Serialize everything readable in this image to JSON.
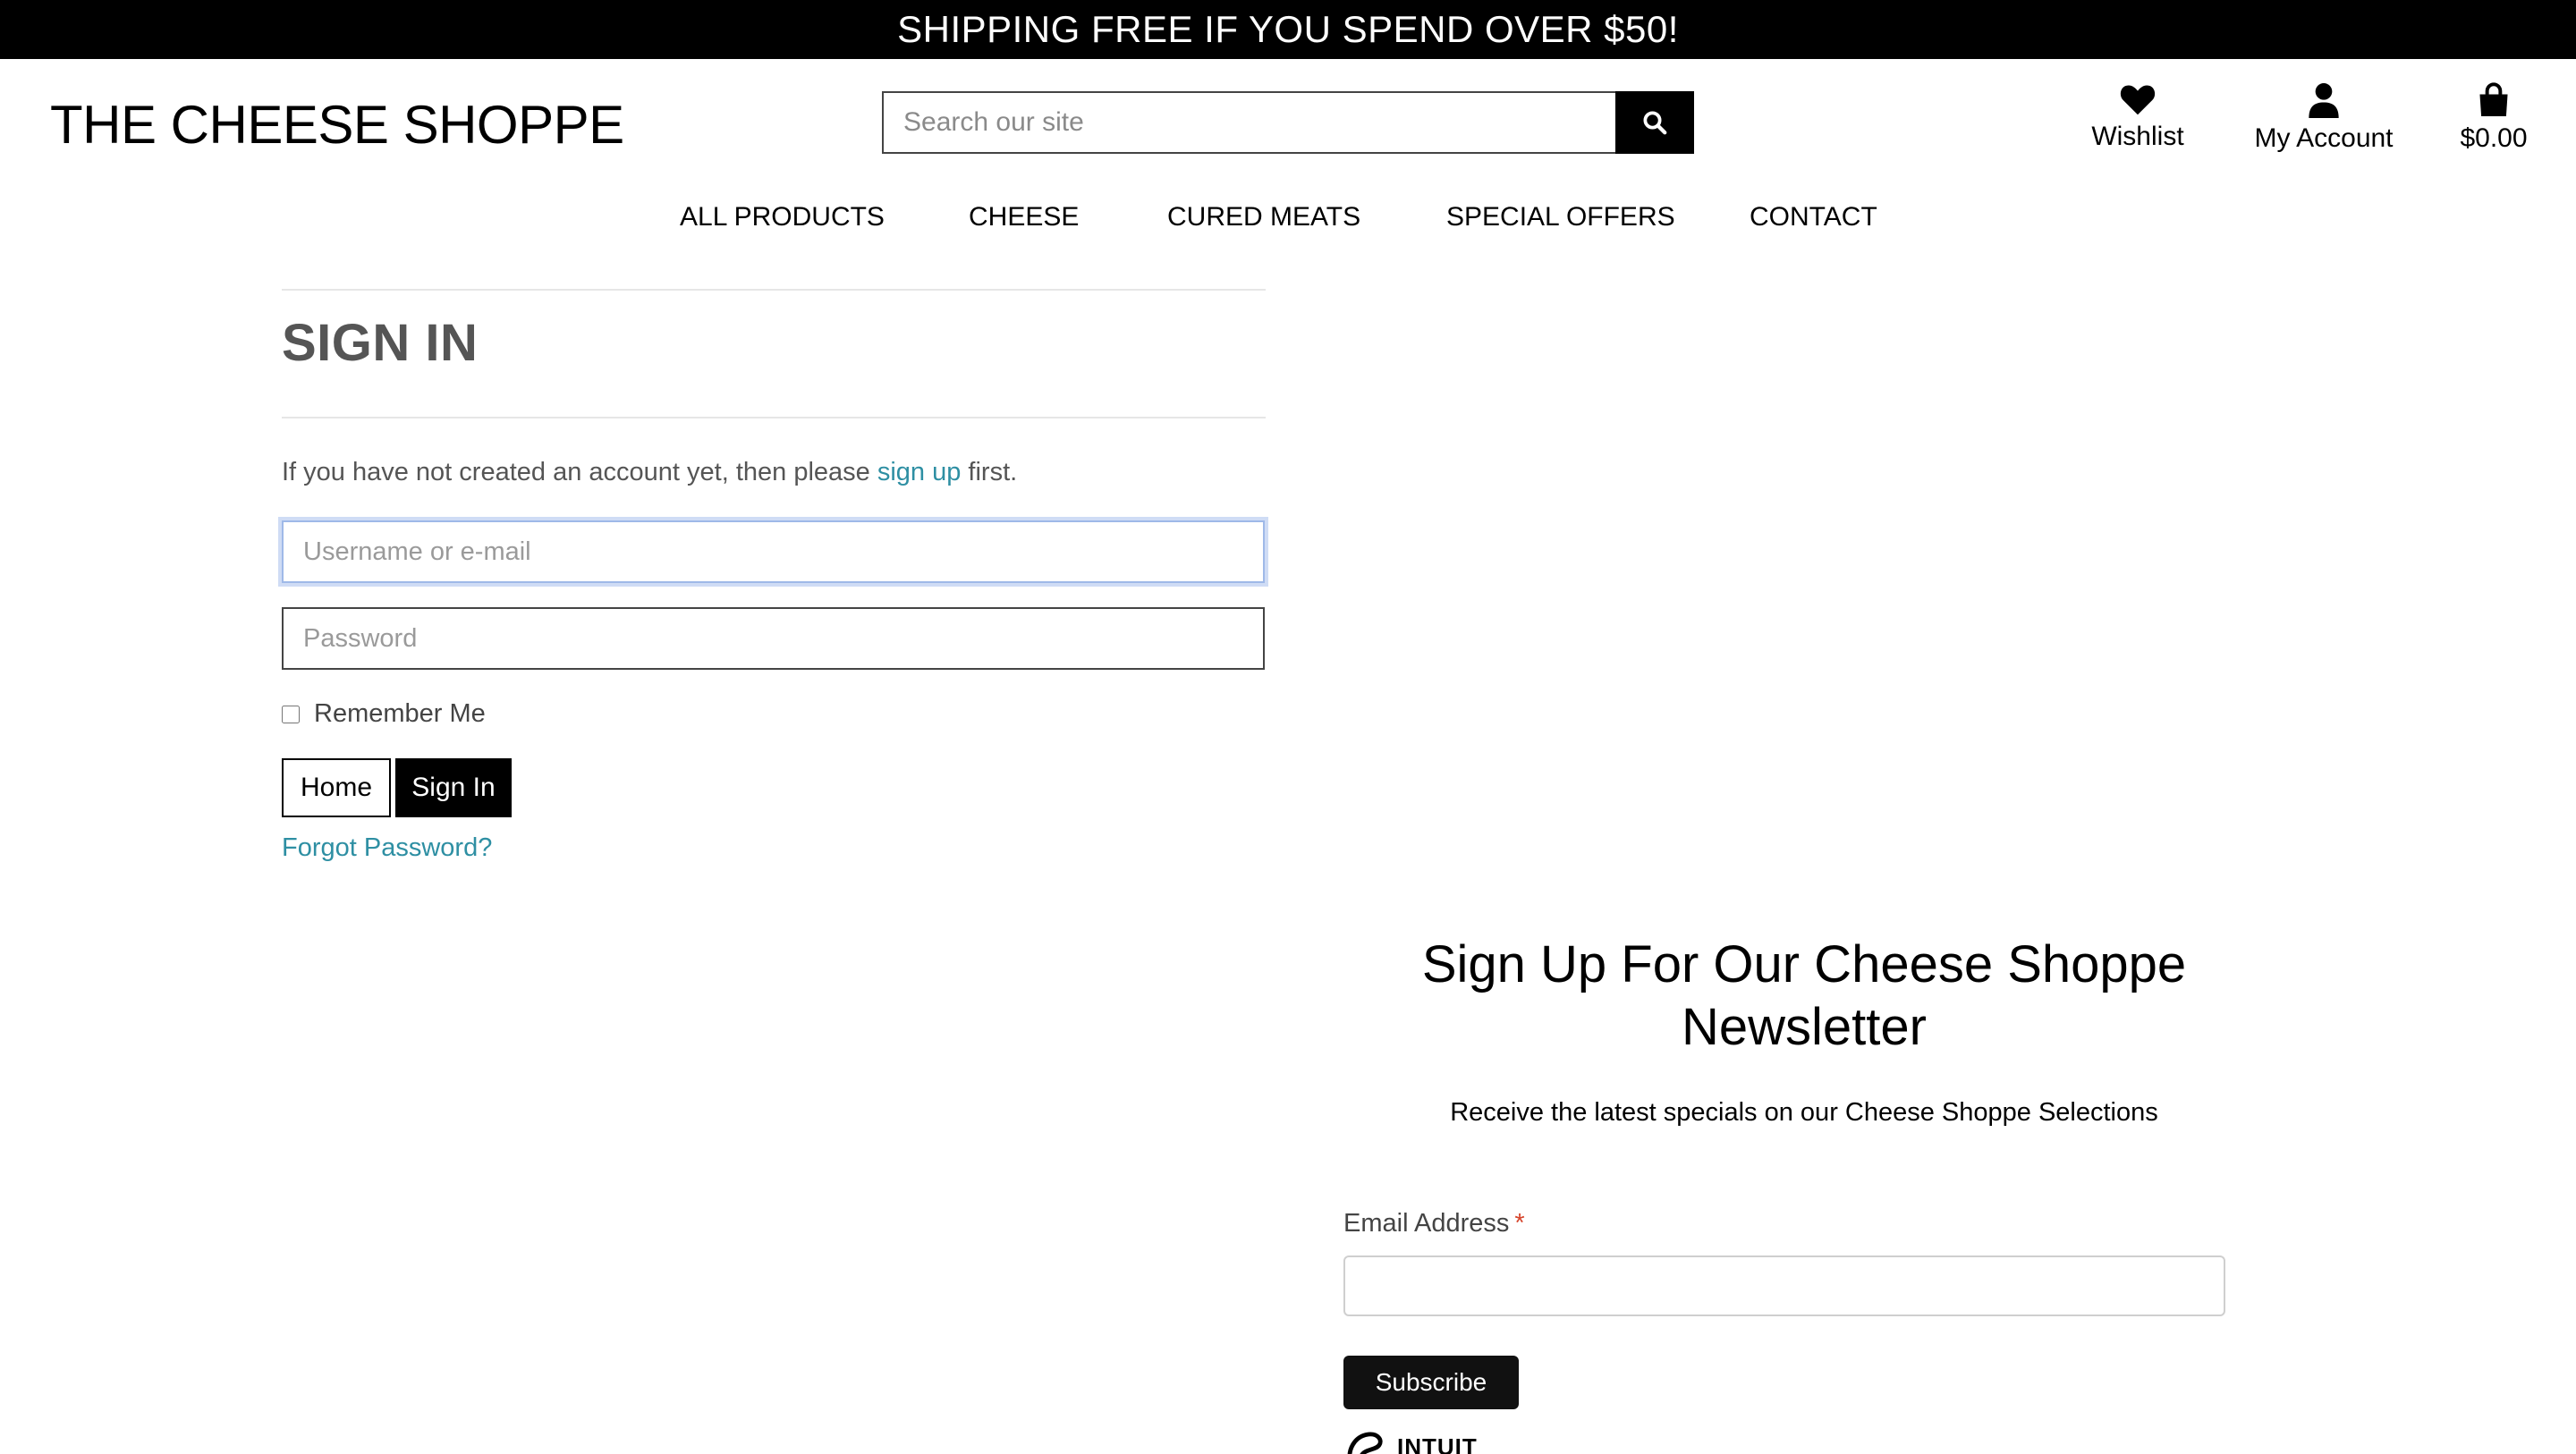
{
  "banner": {
    "text": "SHIPPING FREE IF YOU SPEND OVER $50!"
  },
  "header": {
    "logo": "THE CHEESE SHOPPE",
    "search": {
      "placeholder": "Search our site",
      "icon": "search-icon"
    },
    "links": {
      "wishlist": {
        "label": "Wishlist",
        "icon": "heart-icon"
      },
      "account": {
        "label": "My Account",
        "icon": "user-icon"
      },
      "cart": {
        "label": "$0.00",
        "icon": "shopping-bag-icon"
      }
    }
  },
  "nav": {
    "items": [
      "ALL PRODUCTS",
      "CHEESE",
      "CURED MEATS",
      "SPECIAL OFFERS",
      "CONTACT"
    ]
  },
  "signin": {
    "title": "SIGN IN",
    "intro_before": "If you have not created an account yet, then please ",
    "intro_link": "sign up",
    "intro_after": " first.",
    "username_placeholder": "Username or e-mail",
    "password_placeholder": "Password",
    "remember_label": "Remember Me",
    "home_button": "Home",
    "signin_button": "Sign In",
    "forgot_link": "Forgot Password?"
  },
  "newsletter": {
    "title_line1": "Sign Up For Our Cheese Shoppe",
    "title_line2": "Newsletter",
    "subtitle": "Receive the latest specials on our Cheese Shoppe Selections",
    "email_label": "Email Address",
    "required_mark": "*",
    "subscribe_button": "Subscribe",
    "intuit_text": "INTUIT"
  },
  "colors": {
    "banner_bg": "#000000",
    "link": "#2e8fa3",
    "focus_border": "#9fb9e8",
    "required": "#d6452c"
  }
}
